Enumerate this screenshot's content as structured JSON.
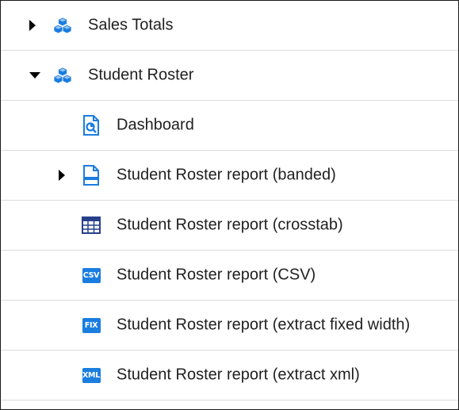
{
  "tree": {
    "items": [
      {
        "label": "Sales Totals",
        "icon": "datasource-cube-icon",
        "expanded": false
      },
      {
        "label": "Student Roster",
        "icon": "datasource-cube-icon",
        "expanded": true
      },
      {
        "label": "Dashboard",
        "icon": "dashboard-document-icon"
      },
      {
        "label": "Student Roster report (banded)",
        "icon": "banded-report-icon",
        "expanded": false
      },
      {
        "label": "Student Roster report (crosstab)",
        "icon": "crosstab-grid-icon"
      },
      {
        "label": "Student Roster report (CSV)",
        "icon": "csv-icon",
        "badge": "CSV"
      },
      {
        "label": "Student Roster report (extract fixed width)",
        "icon": "fix-icon",
        "badge": "FIX"
      },
      {
        "label": "Student Roster report (extract xml)",
        "icon": "xml-icon",
        "badge": "XML"
      }
    ]
  },
  "colors": {
    "icon_blue": "#1a7de0",
    "text": "#1f1f1f",
    "divider": "#dcdcdc",
    "border": "#1a1a1a"
  }
}
